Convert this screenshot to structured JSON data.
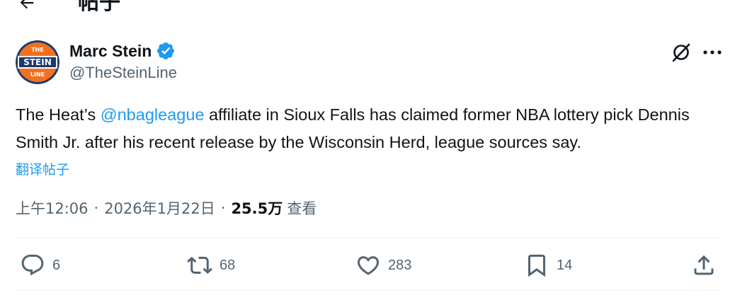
{
  "header": {
    "title": "帖子"
  },
  "author": {
    "name": "Marc Stein",
    "handle": "@TheSteinLine",
    "avatar_text_top": "THE",
    "avatar_text_main": "STEIN",
    "avatar_text_bottom": "LINE"
  },
  "tweet": {
    "text_before": "The Heat’s ",
    "mention": "@nbagleague",
    "text_after": " affiliate in Sioux Falls has claimed former NBA lottery pick Dennis Smith Jr. after his recent release by the Wisconsin Herd, league sources say.",
    "translate_label": "翻译帖子"
  },
  "meta": {
    "time": "上午12:06",
    "separator": "·",
    "date": "2026年1月22日",
    "views_count": "25.5万",
    "views_label": "查看"
  },
  "actions": {
    "replies": "6",
    "reposts": "68",
    "likes": "283",
    "bookmarks": "14"
  },
  "colors": {
    "accent": "#1d9bf0",
    "text": "#0f1419",
    "secondary": "#536471",
    "avatar_orange": "#f37021",
    "avatar_navy": "#1b3a6b"
  },
  "icons": [
    "back-arrow-icon",
    "verified-icon",
    "grok-icon",
    "more-icon",
    "reply-icon",
    "repost-icon",
    "like-icon",
    "bookmark-icon",
    "share-icon"
  ]
}
